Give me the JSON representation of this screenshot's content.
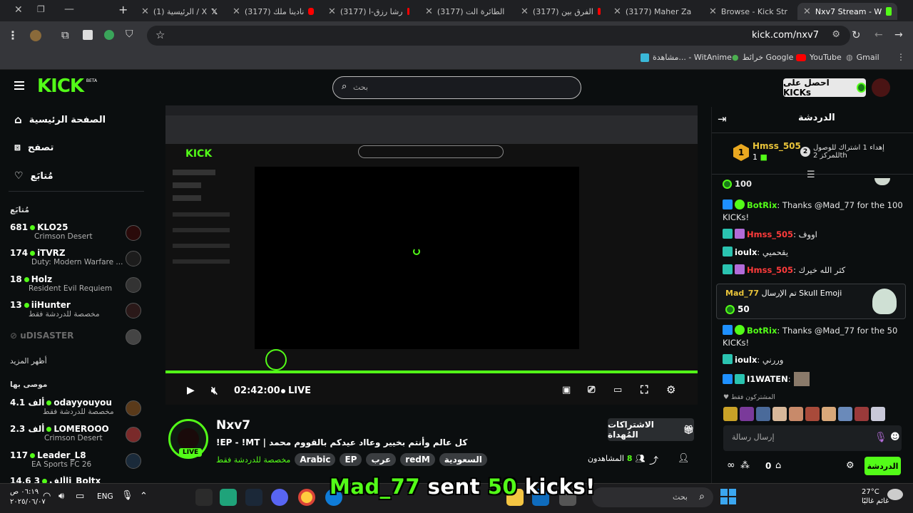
{
  "browser": {
    "tabs": [
      {
        "label": "Nxv7 Stream - W",
        "active": true
      },
      {
        "label": "Browse - Kick Str"
      },
      {
        "label": "(3177) Maher Za"
      },
      {
        "label": "(3177) الفرق بين"
      },
      {
        "label": "(3177) الطائرة الت"
      },
      {
        "label": "(3177) رشا رزق-ا"
      },
      {
        "label": "(3177) نادينا ملك"
      },
      {
        "label": "(1) الرئيسية / X"
      }
    ],
    "url": "kick.com/nxv7",
    "bookmarks": [
      {
        "label": "Gmail"
      },
      {
        "label": "YouTube"
      },
      {
        "label": "خرائط Google"
      },
      {
        "label": "مشاهدة... - WitAnime"
      }
    ]
  },
  "header": {
    "logo": "KICK",
    "logo_tag": "BETA",
    "search_placeholder": "بحث",
    "get_kicks": "احصل على KICKs"
  },
  "sidebar": {
    "nav": [
      {
        "label": "الصفحة الرئيسية"
      },
      {
        "label": "تصفح"
      },
      {
        "label": "مُتابَع"
      }
    ],
    "followed_title": "مُتابَع",
    "followed": [
      {
        "viewers": "681",
        "name": "KLO25",
        "game": "Crimson Desert"
      },
      {
        "viewers": "174",
        "name": "iTVRZ",
        "game": "Duty: Modern Warfare ..."
      },
      {
        "viewers": "18",
        "name": "Holz",
        "game": "Resident Evil Requiem"
      },
      {
        "viewers": "13",
        "name": "iiHunter",
        "game": "مخصصة للدردشة فقط"
      }
    ],
    "offline": "uDISASTER",
    "show_more": "أظهر المزيد",
    "recommended_title": "موصى بها",
    "recommended": [
      {
        "viewers": "4.1 ألف",
        "name": "odayyouyou",
        "game": "مخصصة للدردشة فقط"
      },
      {
        "viewers": "2.3 ألف",
        "name": "LOMEROOO",
        "game": "Crimson Desert"
      },
      {
        "viewers": "117",
        "name": "Leader_L8",
        "game": "EA Sports FC 26"
      },
      {
        "viewers": "14.6 ألف",
        "name": "3li_Boltx",
        "game": ""
      }
    ]
  },
  "player": {
    "time": "02:42:00",
    "live": "LIVE"
  },
  "stream": {
    "channel": "Nxv7",
    "title": "!EP - !MT | كل عالم وأنتم بخيير وعااد عيدكم بالقووم محمد",
    "category": "مخصصة للدردشة فقط",
    "tags": [
      "Arabic",
      "EP",
      "عرب",
      "redM",
      "السعودية"
    ],
    "viewers_label": "المشاهدون",
    "viewers": "8",
    "gift_subs": "الاشتراكات المُهداة",
    "live_badge": "LIVE"
  },
  "chat": {
    "title": "الدردشة",
    "leader_name": "Hmss_505",
    "leader_count": "1",
    "leader_rank": "1",
    "gift_note": "إهداء 1 اشتراك للوصول للمركز 2th",
    "gift_rank": "2",
    "kicks_top": "100",
    "messages": [
      {
        "user": "BotRix",
        "text": "Thanks @Mad_77 for the 100 KICKs!",
        "color": "#53fc18"
      },
      {
        "user": "Hmss_505",
        "text": "اووف",
        "color": "#ff3b3b"
      },
      {
        "user": "ioulx",
        "text": "يقحميي",
        "color": "#ffffff"
      },
      {
        "user": "Hmss_505",
        "text": "كثر الله خيرك",
        "color": "#ff3b3b"
      }
    ],
    "gift_card": {
      "user": "Mad_77",
      "text": "تم الإرسال Skull Emoji",
      "amount": "50"
    },
    "messages2": [
      {
        "user": "BotRix",
        "text": "Thanks @Mad_77 for the 50 KICKs!",
        "color": "#53fc18"
      },
      {
        "user": "ioulx",
        "text": "وررني",
        "color": "#ffffff"
      },
      {
        "user": "I1WATEN",
        "text": "",
        "color": "#ffffff"
      }
    ],
    "subs_only": "المشتركون فقط",
    "input_placeholder": "إرسال رسالة",
    "send": "الدردشة",
    "points": "0"
  },
  "overlay_text": {
    "user": "Mad_77",
    "mid": "sent",
    "amount": "50",
    "end": "kicks!"
  },
  "taskbar": {
    "weather_temp": "27°C",
    "weather_desc": "غائم غالبًا",
    "search": "بحث",
    "lang": "ENG",
    "time": "٠٦:١٩ ص",
    "date": "٢٠٢٥/٠٦/٠٧"
  },
  "colors": {
    "accent": "#53fc18",
    "bg": "#0b0e0f"
  }
}
